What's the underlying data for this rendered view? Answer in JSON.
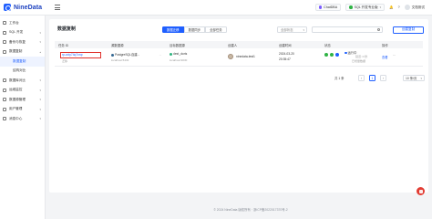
{
  "brand": {
    "name": "NineData"
  },
  "topbar": {
    "chatdba": "ChatDBA",
    "org": "SQL 开发专业版",
    "docs": "文档测试"
  },
  "sidebar": {
    "items": [
      {
        "label": "工作台",
        "icon": "home-icon"
      },
      {
        "label": "SQL 开发",
        "icon": "code-icon"
      },
      {
        "label": "备份与恢复",
        "icon": "backup-icon"
      },
      {
        "label": "数据复制",
        "icon": "copy-icon",
        "active": true
      },
      {
        "label": "结构对比",
        "icon": "",
        "sub": true
      },
      {
        "label": "数据库对比",
        "icon": "compare-icon"
      },
      {
        "label": "运维监控",
        "icon": "monitor-icon"
      },
      {
        "label": "数据源管理",
        "icon": "database-icon"
      },
      {
        "label": "用户管理",
        "icon": "user-icon"
      },
      {
        "label": "消息中心",
        "icon": "bell-icon"
      }
    ]
  },
  "main": {
    "title": "数据复制",
    "filters": [
      "数据迁移",
      "数据同步",
      "全部任务"
    ],
    "status_select": "全部状态",
    "create_button": "创建复制"
  },
  "table": {
    "headers": [
      "任务 ID",
      "源数据源",
      "目标数据源",
      "创建人",
      "创建时间",
      "状态",
      "操作"
    ],
    "rows": [
      {
        "id": "rp-zcty74q7xnp",
        "id_sub": "迁移",
        "source": "PostgreSQL自建...",
        "source_sub": "localhost:5432",
        "target": "dest_doris",
        "target_sub": "localhost:9030",
        "creator": "ninedata-test1",
        "created_date": "2024-03-20",
        "created_time": "20:35:47",
        "status_line1": "运行中",
        "status_line2": "延迟: 0 秒",
        "status_line3": "已增量数据",
        "action": "查看"
      }
    ]
  },
  "pagination": {
    "total": "共 1 条",
    "current_page": "1",
    "page_size": "10 条/页",
    "prev": "‹",
    "next": "›"
  },
  "footer": {
    "text": "© 2024 NineData 版权所有 · 浙ICP备2022017370号-2"
  }
}
